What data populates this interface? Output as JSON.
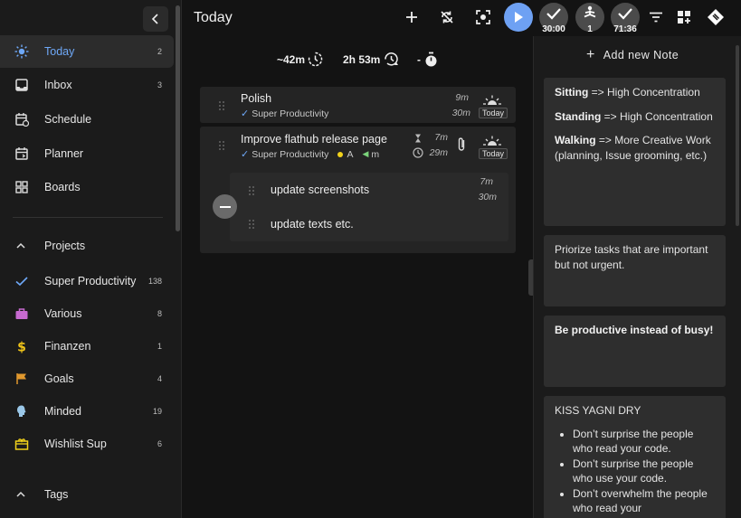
{
  "header": {
    "title": "Today",
    "timer_1": "30:00",
    "focus_count": "1",
    "timer_2": "71:36"
  },
  "sidebar": {
    "items": [
      {
        "label": "Today",
        "count": "2",
        "icon": "sun-icon"
      },
      {
        "label": "Inbox",
        "count": "3",
        "icon": "inbox-icon"
      },
      {
        "label": "Schedule",
        "count": "",
        "icon": "schedule-icon"
      },
      {
        "label": "Planner",
        "count": "",
        "icon": "planner-icon"
      },
      {
        "label": "Boards",
        "count": "",
        "icon": "boards-icon"
      }
    ],
    "projects_label": "Projects",
    "projects": [
      {
        "label": "Super Productivity",
        "count": "138",
        "color": "#6ea8f7"
      },
      {
        "label": "Various",
        "count": "8",
        "color": "#c76ad0"
      },
      {
        "label": "Finanzen",
        "count": "1",
        "color": "#f0c419"
      },
      {
        "label": "Goals",
        "count": "4",
        "color": "#e0982e"
      },
      {
        "label": "Minded",
        "count": "19",
        "color": "#9ac7e8"
      },
      {
        "label": "Wishlist Sup",
        "count": "6",
        "color": "#f2d21b"
      }
    ],
    "tags_label": "Tags"
  },
  "stats": {
    "estimate": "~42m",
    "worked": "2h 53m",
    "break": "-"
  },
  "tasks": [
    {
      "title": "Polish",
      "project": "Super Productivity",
      "estimate": "9m",
      "spent": "30m",
      "badge": "Today"
    },
    {
      "title": "Improve flathub release page",
      "project": "Super Productivity",
      "tag_a": "A",
      "tag_m": "m",
      "estimate": "7m",
      "spent": "29m",
      "badge": "Today",
      "subtasks": [
        {
          "title": "update screenshots",
          "estimate": "7m",
          "spent": "30m"
        },
        {
          "title": "update texts etc."
        }
      ]
    }
  ],
  "notes": {
    "add_label": "Add new Note",
    "note1": {
      "sitting": "Sitting",
      "sitting_rest": " => High Concentration",
      "standing": "Standing",
      "standing_rest": " => High Concentration",
      "walking": "Walking",
      "walking_rest": " => More Creative Work (planning, Issue grooming, etc.)"
    },
    "note2": "Priorize tasks that are important but not urgent.",
    "note3": "Be productive instead of busy!",
    "note4": {
      "title": "KISS YAGNI DRY",
      "items": [
        "Don’t surprise the people who read your code.",
        "Don’t surprise the people who use your code.",
        "Don’t overwhelm the people who read your"
      ]
    }
  }
}
